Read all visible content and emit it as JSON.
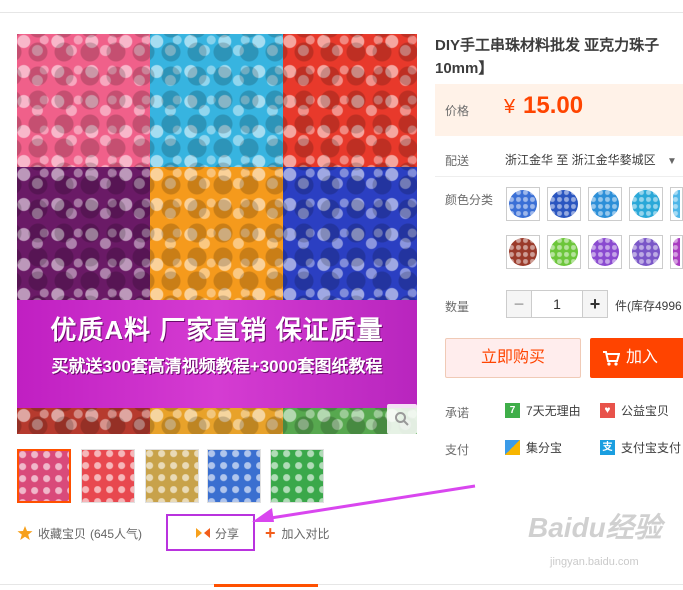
{
  "product": {
    "title_line1": "DIY手工串珠材料批发 亚克力珠子",
    "title_line2": "10mm】"
  },
  "gallery": {
    "banner_line1": "优质A料  厂家直销  保证质量",
    "banner_line2": "买就送300套高清视频教程+3000套图纸教程",
    "tile_colors": [
      "#f0608a",
      "#37b4e0",
      "#e8392b",
      "#6a1a66",
      "#f59a1c",
      "#2b3fc2",
      "#b63a2e",
      "#e8a22a",
      "#57a84f"
    ],
    "thumb_colors": [
      "#d94a7a",
      "#e8484f",
      "#c8a24a",
      "#3a6fd0",
      "#3aa84a"
    ]
  },
  "actions": {
    "favorite_label": "收藏宝贝",
    "favorite_count": "(645人气)",
    "share_label": "分享",
    "compare_label": "加入对比"
  },
  "price": {
    "label": "价格",
    "currency": "¥",
    "value": "15.00"
  },
  "shipping": {
    "label": "配送",
    "text": "浙江金华 至  浙江金华婺城区"
  },
  "colors": {
    "label": "颜色分类",
    "swatches": [
      "#3a6fd6",
      "#2a55c0",
      "#2c8fd8",
      "#2aa8d8",
      "#4fb6e8",
      "#9a3a2a",
      "#6cc63a",
      "#8a4ad0",
      "#7a56c8",
      "#a83cc0"
    ]
  },
  "quantity": {
    "label": "数量",
    "minus": "−",
    "value": "1",
    "plus": "+",
    "stock": "件(库存4996"
  },
  "buttons": {
    "buy_now": "立即购买",
    "add_cart": "加入"
  },
  "promise": {
    "label": "承诺",
    "item1": "7天无理由",
    "item2": "公益宝贝"
  },
  "payment": {
    "label": "支付",
    "item1": "集分宝",
    "item2": "支付宝支付"
  },
  "watermark": {
    "brand": "Baidu经验",
    "url": "jingyan.baidu.com"
  }
}
